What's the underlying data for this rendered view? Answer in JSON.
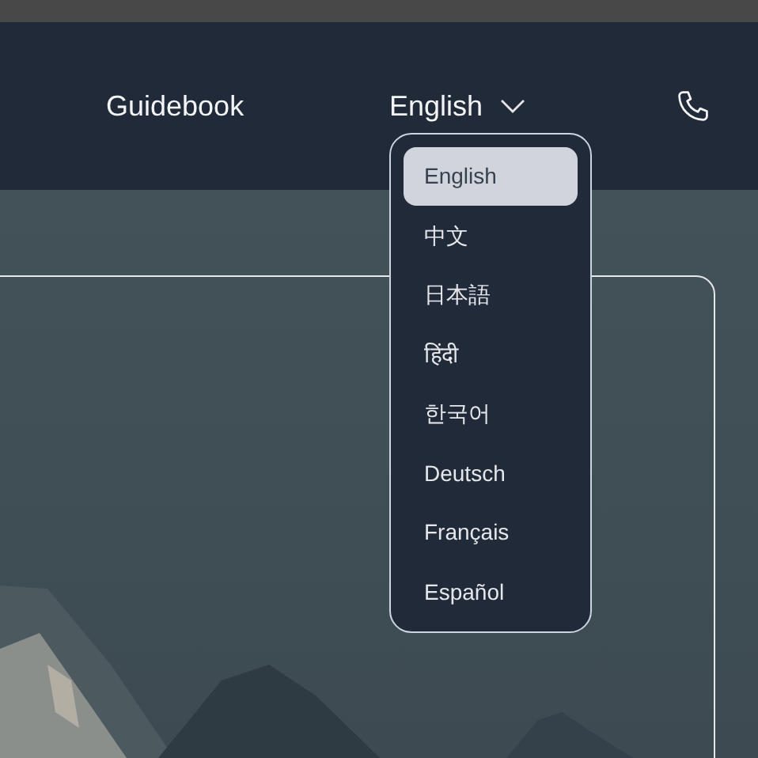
{
  "navbar": {
    "links": [
      {
        "label": "Guidebook"
      }
    ],
    "language_button": {
      "label": "English",
      "expanded": true
    }
  },
  "language_menu": {
    "options": [
      {
        "label": "English",
        "selected": true
      },
      {
        "label": "中文",
        "selected": false
      },
      {
        "label": "日本語",
        "selected": false
      },
      {
        "label": "हिंदी",
        "selected": false
      },
      {
        "label": "한국어",
        "selected": false
      },
      {
        "label": "Deutsch",
        "selected": false
      },
      {
        "label": "Français",
        "selected": false
      },
      {
        "label": "Español",
        "selected": false
      }
    ]
  }
}
